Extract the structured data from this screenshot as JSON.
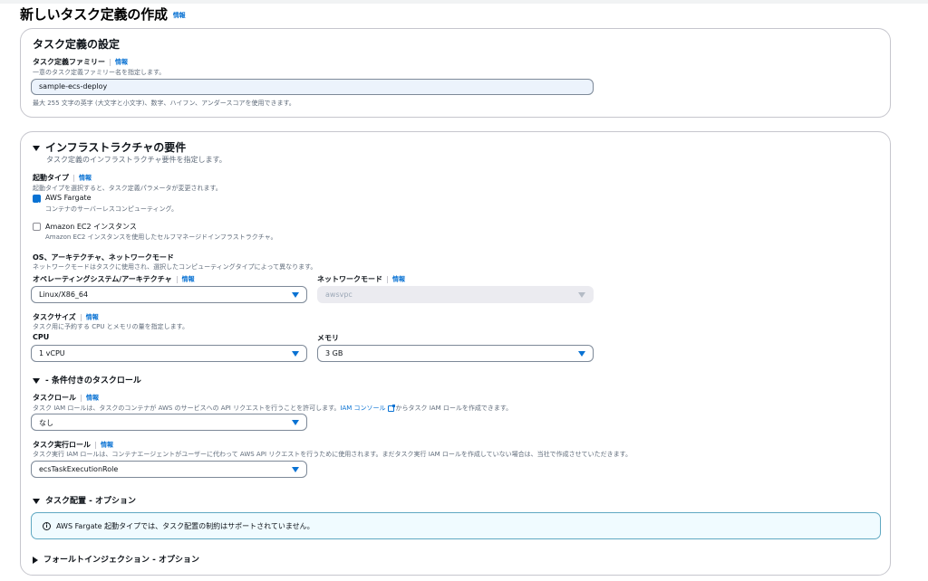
{
  "page": {
    "title": "新しいタスク定義の作成",
    "info": "情報"
  },
  "section1": {
    "title": "タスク定義の設定",
    "family_label": "タスク定義ファミリー",
    "family_info": "情報",
    "family_desc": "一意のタスク定義ファミリー名を指定します。",
    "family_value": "sample-ecs-deploy",
    "family_hint": "最大 255 文字の英字 (大文字と小文字)、数字、ハイフン、アンダースコアを使用できます。"
  },
  "section2": {
    "title": "インフラストラクチャの要件",
    "subtitle": "タスク定義のインフラストラクチャ要件を指定します。",
    "launch_type_label": "起動タイプ",
    "launch_type_info": "情報",
    "launch_type_desc": "起動タイプを選択すると、タスク定義パラメータが変更されます。",
    "fargate_label": "AWS Fargate",
    "fargate_desc": "コンテナのサーバーレスコンピューティング。",
    "ec2_label": "Amazon EC2 インスタンス",
    "ec2_desc": "Amazon EC2 インスタンスを使用したセルフマネージドインフラストラクチャ。",
    "os_arch_net_label": "OS、アーキテクチャ、ネットワークモード",
    "os_arch_net_desc": "ネットワークモードはタスクに使用され、選択したコンピューティングタイプによって異なります。",
    "os_label": "オペレーティングシステム/アーキテクチャ",
    "os_info": "情報",
    "os_value": "Linux/X86_64",
    "net_label": "ネットワークモード",
    "net_info": "情報",
    "net_value": "awsvpc",
    "task_size_label": "タスクサイズ",
    "task_size_info": "情報",
    "task_size_desc": "タスク用に予約する CPU とメモリの量を指定します。",
    "cpu_label": "CPU",
    "cpu_value": "1 vCPU",
    "memory_label": "メモリ",
    "memory_value": "3 GB",
    "cond_role_title": "- 条件付きのタスクロール",
    "task_role_label": "タスクロール",
    "task_role_info": "情報",
    "task_role_desc_a": "タスク IAM ロールは、タスクのコンテナが AWS のサービスへの API リクエストを行うことを許可します。",
    "task_role_link": "IAM コンソール",
    "task_role_desc_b": "からタスク IAM ロールを作成できます。",
    "task_role_value": "なし",
    "exec_role_label": "タスク実行ロール",
    "exec_role_info": "情報",
    "exec_role_desc": "タスク実行 IAM ロールは、コンテナエージェントがユーザーに代わって AWS API リクエストを行うために使用されます。まだタスク実行 IAM ロールを作成していない場合は、当社で作成させていただきます。",
    "exec_role_value": "ecsTaskExecutionRole",
    "placement_title": "タスク配置 - オプション",
    "placement_alert": "AWS Fargate 起動タイプでは、タスク配置の制約はサポートされていません。",
    "fault_title": "フォールトインジェクション - オプション"
  },
  "icons": {
    "check": "check-icon",
    "info": "info-circle-icon",
    "external": "external-link-icon"
  },
  "colors": {
    "link": "#0972d3",
    "alert_border": "#5fa8c2",
    "input_bg": "#ecf3fc"
  }
}
